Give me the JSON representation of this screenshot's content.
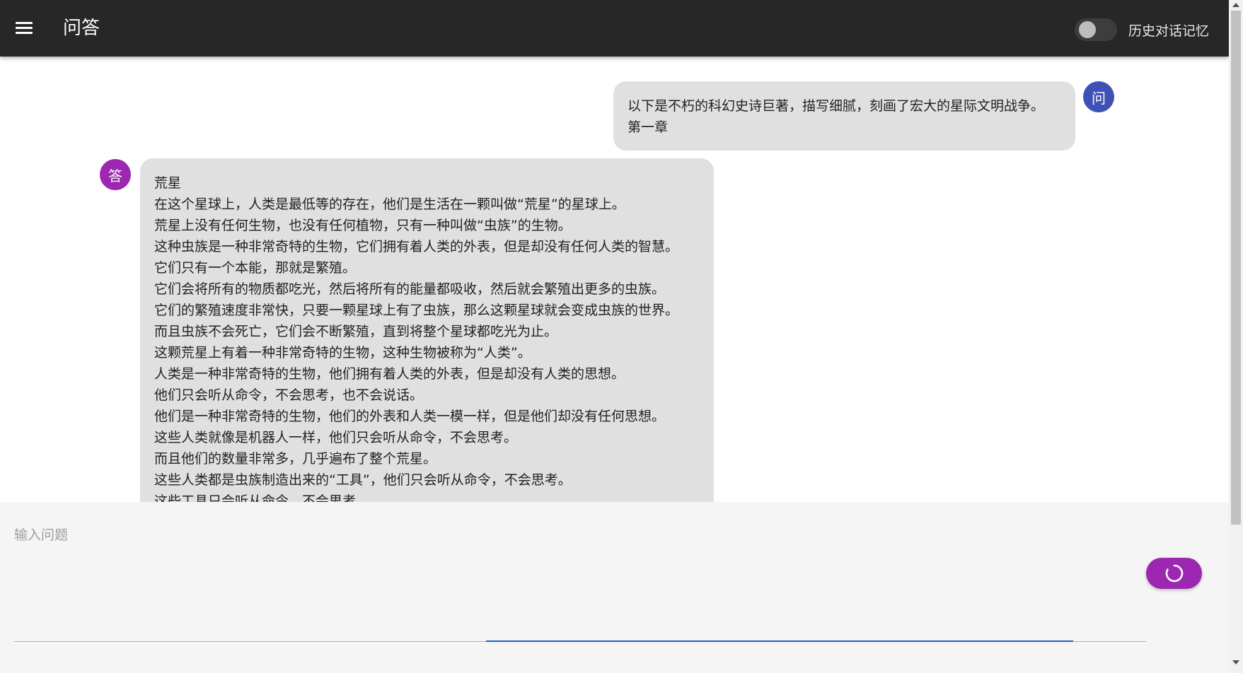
{
  "appbar": {
    "menu_icon": "hamburger-menu-icon",
    "title": "问答",
    "history_toggle": {
      "label": "历史对话记忆",
      "on": false
    }
  },
  "colors": {
    "appbar": "#272727",
    "question_avatar": "#3f51b5",
    "answer_avatar": "#9c27b0",
    "bubble": "#e0e0e0",
    "send_button": "#9c27b0",
    "input_bg": "#f5f5f5"
  },
  "chat": {
    "question": {
      "avatar": "问",
      "lines": [
        "以下是不朽的科幻史诗巨著，描写细腻，刻画了宏大的星际文明战争。",
        "第一章"
      ]
    },
    "answer": {
      "avatar": "答",
      "lines": [
        "荒星",
        "在这个星球上，人类是最低等的存在，他们是生活在一颗叫做“荒星”的星球上。",
        "荒星上没有任何生物，也没有任何植物，只有一种叫做“虫族”的生物。",
        "这种虫族是一种非常奇特的生物，它们拥有着人类的外表，但是却没有任何人类的智慧。",
        "它们只有一个本能，那就是繁殖。",
        "它们会将所有的物质都吃光，然后将所有的能量都吸收，然后就会繁殖出更多的虫族。",
        "它们的繁殖速度非常快，只要一颗星球上有了虫族，那么这颗星球就会变成虫族的世界。",
        "而且虫族不会死亡，它们会不断繁殖，直到将整个星球都吃光为止。",
        "这颗荒星上有着一种非常奇特的生物，这种生物被称为“人类”。",
        "人类是一种非常奇特的生物，他们拥有着人类的外表，但是却没有人类的思想。",
        "他们只会听从命令，不会思考，也不会说话。",
        "他们是一种非常奇特的生物，他们的外表和人类一模一样，但是他们却没有任何思想。",
        "这些人类就像是机器人一样，他们只会听从命令，不会思考。",
        "而且他们的数量非常多，几乎遍布了整个荒星。",
        "这些人类都是虫族制造出来的“工具”，他们只会听从命令，不会思考。",
        "这些工具只会听从命令，不会思考"
      ]
    }
  },
  "input": {
    "placeholder": "输入问题",
    "value": "",
    "send_icon": "loading-spinner-icon"
  }
}
